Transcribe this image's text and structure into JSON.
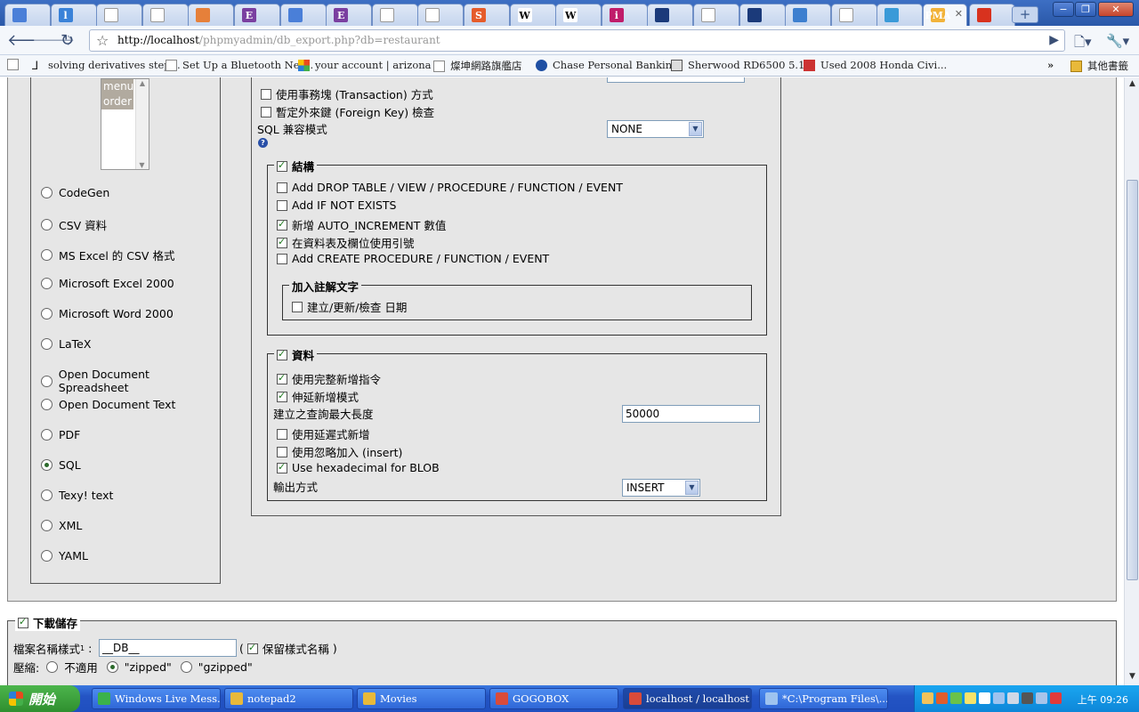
{
  "browser": {
    "url_host": "http://localhost",
    "url_path": "/phpmyadmin/db_export.php?db=restaurant",
    "active_tab_label": "PMA",
    "tabs": [
      {
        "icon": "google-icon",
        "label": ""
      },
      {
        "icon": "refresh-site-icon",
        "label": "l"
      },
      {
        "icon": "page-icon",
        "label": ""
      },
      {
        "icon": "page-icon",
        "label": ""
      },
      {
        "icon": "gear-site-icon",
        "label": ""
      },
      {
        "icon": "e-site-icon",
        "label": "E"
      },
      {
        "icon": "google-icon",
        "label": ""
      },
      {
        "icon": "e-site-icon",
        "label": "E"
      },
      {
        "icon": "page-icon",
        "label": ""
      },
      {
        "icon": "page-icon",
        "label": ""
      },
      {
        "icon": "s-site-icon",
        "label": "S"
      },
      {
        "icon": "wikipedia-icon",
        "label": "W"
      },
      {
        "icon": "wikipedia-icon",
        "label": "W"
      },
      {
        "icon": "info-site-icon",
        "label": "i"
      },
      {
        "icon": "image-site-icon",
        "label": ""
      },
      {
        "icon": "page-icon",
        "label": ""
      },
      {
        "icon": "image-site-icon",
        "label": ""
      },
      {
        "icon": "app-site-icon",
        "label": ""
      },
      {
        "icon": "page-icon",
        "label": ""
      },
      {
        "icon": "chat-site-icon",
        "label": ""
      },
      {
        "icon": "pma-icon",
        "label": "PMA"
      },
      {
        "icon": "red-site-icon",
        "label": ""
      }
    ],
    "bookmarks": [
      "solving derivatives step...",
      "Set Up a Bluetooth Net...",
      "your account | arizona ...",
      "燦坤網路旗艦店",
      "Chase Personal Bankin...",
      "Sherwood RD6500 5.1...",
      "Used 2008 Honda Civi...",
      "其他書籤"
    ],
    "bookmarks_overflow": "»"
  },
  "format_list": {
    "listbox_items": [
      "menu",
      "order"
    ],
    "formats": [
      {
        "label": "CodeGen",
        "selected": false
      },
      {
        "label": "CSV 資料",
        "selected": false
      },
      {
        "label": "MS Excel 的 CSV 格式",
        "selected": false
      },
      {
        "label": "Microsoft Excel 2000",
        "selected": false
      },
      {
        "label": "Microsoft Word 2000",
        "selected": false
      },
      {
        "label": "LaTeX",
        "selected": false
      },
      {
        "label": "Open Document Spreadsheet",
        "selected": false
      },
      {
        "label": "Open Document Text",
        "selected": false
      },
      {
        "label": "PDF",
        "selected": false
      },
      {
        "label": "SQL",
        "selected": true
      },
      {
        "label": "Texy! text",
        "selected": false
      },
      {
        "label": "XML",
        "selected": false
      },
      {
        "label": "YAML",
        "selected": false
      }
    ]
  },
  "options": {
    "transaction_label": "使用事務塊 (Transaction) 方式",
    "foreign_key_label": "暫定外來鍵 (Foreign Key) 檢查",
    "sql_compat_label": "SQL 兼容模式",
    "sql_compat_value": "NONE",
    "help_icon": "?",
    "structure": {
      "legend": "結構",
      "checked": true,
      "items": [
        {
          "label": "Add DROP TABLE / VIEW / PROCEDURE / FUNCTION / EVENT",
          "checked": false
        },
        {
          "label": "Add IF NOT EXISTS",
          "checked": false
        },
        {
          "label": "新增 AUTO_INCREMENT 數值",
          "checked": true
        },
        {
          "label": "在資料表及欄位使用引號",
          "checked": true
        },
        {
          "label": "Add CREATE PROCEDURE / FUNCTION / EVENT",
          "checked": false
        }
      ],
      "comments_legend": "加入註解文字",
      "comments_item": "建立/更新/檢查 日期"
    },
    "data": {
      "legend": "資料",
      "checked": true,
      "complete_inserts": "使用完整新增指令",
      "extended_inserts": "伸延新增模式",
      "max_query_label": "建立之查詢最大長度",
      "max_query_value": "50000",
      "delayed_inserts": "使用延遲式新增",
      "ignore_inserts": "使用忽略加入 (insert)",
      "hex_blob": "Use hexadecimal for BLOB",
      "export_type_label": "輸出方式",
      "export_type_value": "INSERT"
    }
  },
  "save": {
    "legend": "下載儲存",
    "filename_label": "檔案名稱樣式",
    "filename_sup": "1",
    "filename_value": "__DB__",
    "paren_open": "(",
    "paren_close": ")",
    "remember_label": "保留樣式名稱",
    "compression_label": "壓縮:",
    "compression_options": [
      {
        "label": "不適用",
        "selected": false
      },
      {
        "label": "\"zipped\"",
        "selected": true
      },
      {
        "label": "\"gzipped\"",
        "selected": false
      }
    ]
  },
  "taskbar": {
    "start_label": "開始",
    "tasks": [
      "Windows Live Mess...",
      "notepad2",
      "Movies",
      "GOGOBOX",
      "localhost / localhost /...",
      "*C:\\Program Files\\..."
    ],
    "clock": "上午 09:26"
  }
}
